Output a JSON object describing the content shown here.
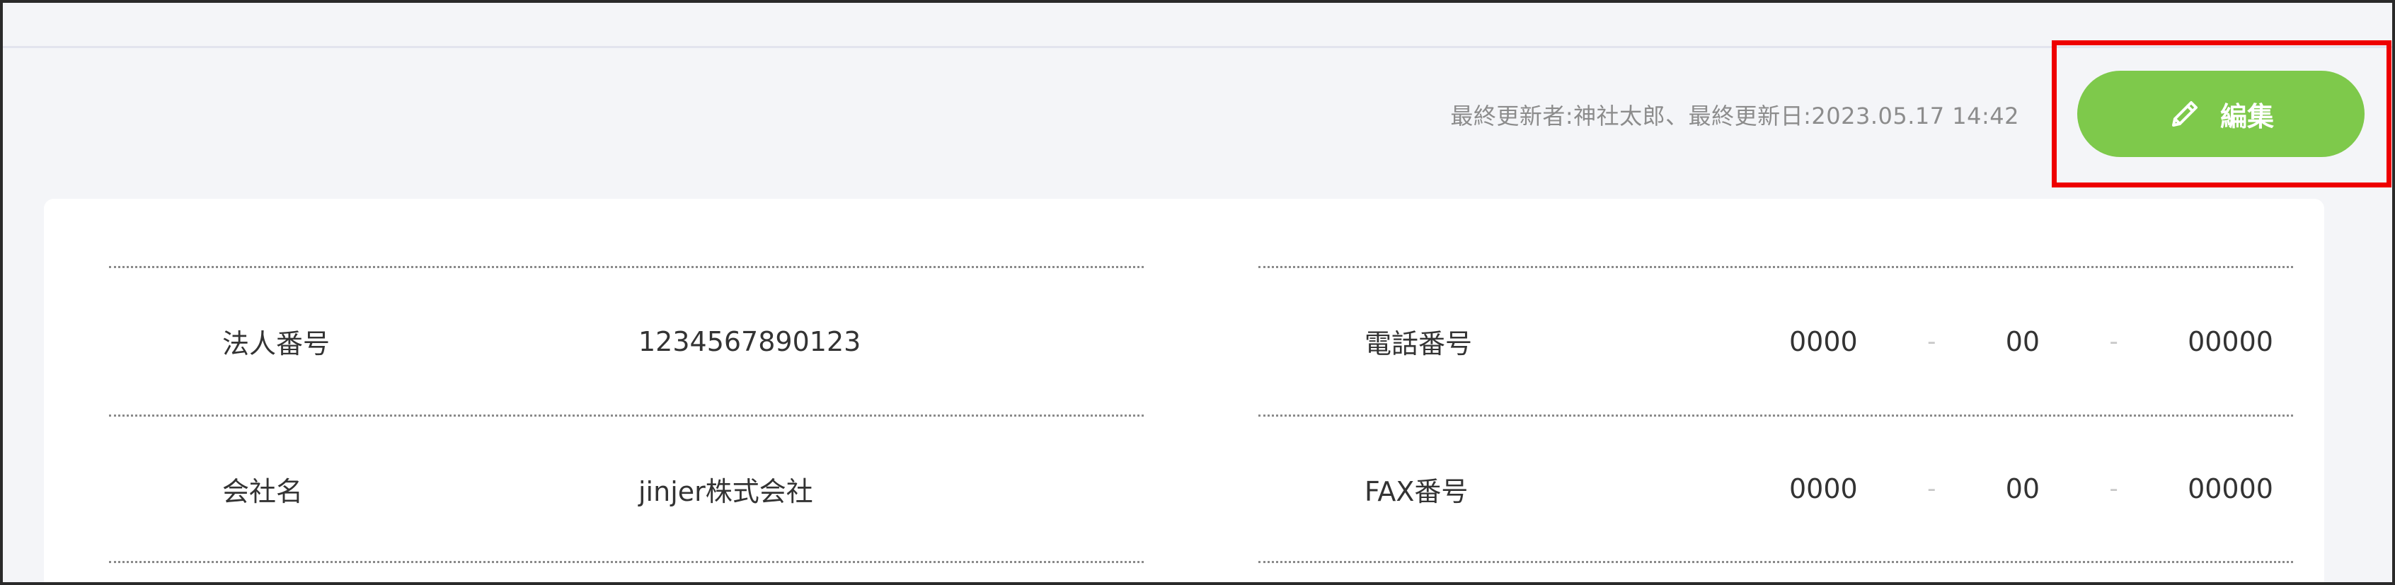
{
  "header": {
    "meta_text": "最終更新者:神社太郎、最終更新日:2023.05.17 14:42",
    "edit_label": "編集"
  },
  "fields_left": [
    {
      "label": "法人番号",
      "value": "1234567890123"
    },
    {
      "label": "会社名",
      "value": "jinjer株式会社"
    }
  ],
  "fields_right": [
    {
      "label": "電話番号",
      "parts": [
        "0000",
        "00",
        "00000"
      ],
      "separator": "-"
    },
    {
      "label": "FAX番号",
      "parts": [
        "0000",
        "00",
        "00000"
      ],
      "separator": "-"
    }
  ],
  "colors": {
    "accent": "#7ec94b",
    "highlight": "#ee0000",
    "page_bg": "#f4f5f8"
  },
  "icons": {
    "edit": "pencil-icon"
  }
}
